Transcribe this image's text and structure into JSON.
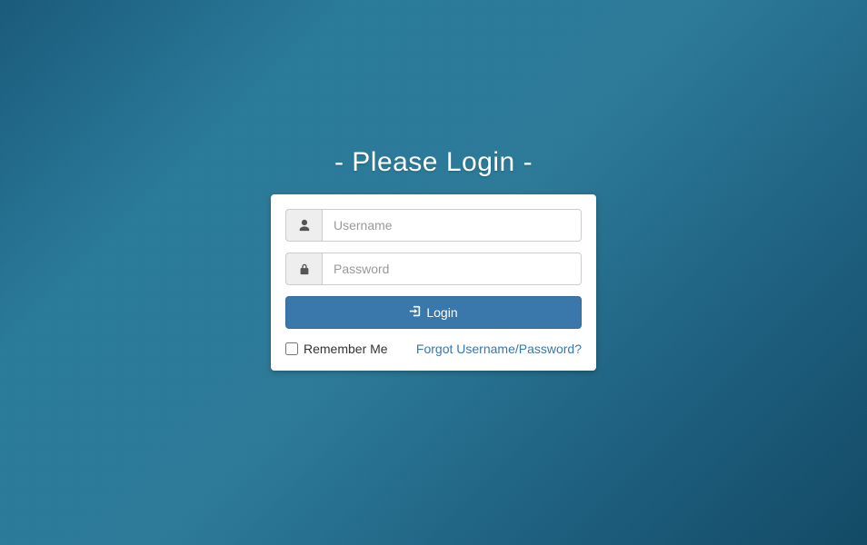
{
  "header": {
    "title": "- Please Login -"
  },
  "form": {
    "username_placeholder": "Username",
    "password_placeholder": "Password",
    "login_button_label": "Login",
    "remember_label": "Remember Me",
    "forgot_label": "Forgot Username/Password?"
  }
}
